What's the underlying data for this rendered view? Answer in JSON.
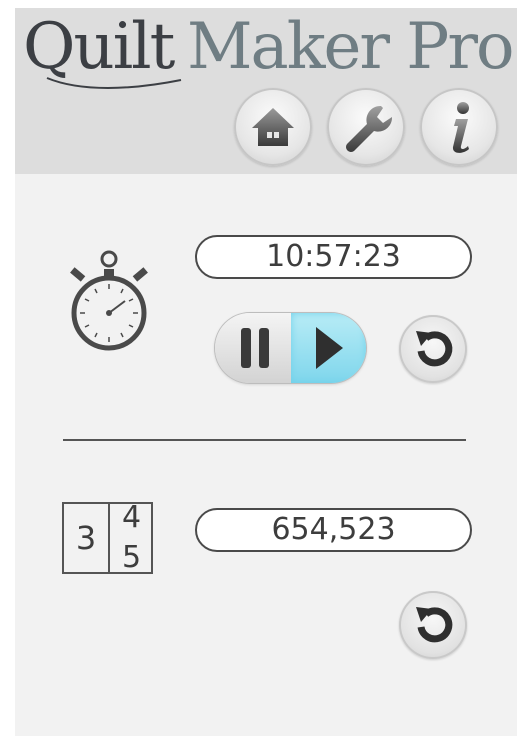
{
  "header": {
    "logo_part1": "Quilt",
    "logo_part2": "Maker Pro",
    "buttons": [
      {
        "name": "home",
        "icon": "home-icon"
      },
      {
        "name": "settings",
        "icon": "wrench-icon"
      },
      {
        "name": "info",
        "icon": "info-icon"
      }
    ]
  },
  "timer": {
    "icon": "stopwatch-icon",
    "value": "10:57:23",
    "pause_icon": "pause-icon",
    "play_icon": "play-icon",
    "active": "play",
    "reset_icon": "reset-icon"
  },
  "counter": {
    "icon": "tally-counter-icon",
    "icon_digits": [
      "3",
      "4",
      "5"
    ],
    "value": "654,523",
    "reset_icon": "reset-icon"
  },
  "colors": {
    "background": "#f2f2f2",
    "header": "#dddddd",
    "text": "#3d3d3d",
    "accent_active": "#8fdcef"
  }
}
